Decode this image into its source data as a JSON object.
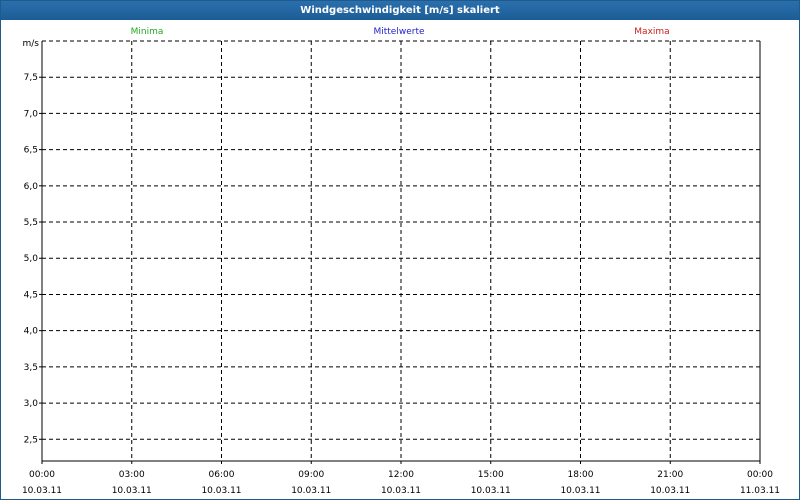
{
  "window": {
    "title": "Windgeschwindigkeit [m/s] skaliert"
  },
  "colors": {
    "minima": "#22aa22",
    "mittelwerte": "#2222cc",
    "maxima": "#cc2222",
    "titlebar": "#1f5a8c"
  },
  "chart_data": {
    "type": "line",
    "title": "Windgeschwindigkeit [m/s] skaliert",
    "ylabel": "m/s",
    "xlabel": "",
    "ylim": [
      2.2,
      8.0
    ],
    "yticks": [
      2.5,
      3.0,
      3.5,
      4.0,
      4.5,
      5.0,
      5.5,
      6.0,
      6.5,
      7.0,
      7.5
    ],
    "ytick_labels": [
      "2,5",
      "3,0",
      "3,5",
      "4,0",
      "4,5",
      "5,0",
      "5,5",
      "6,0",
      "6,5",
      "7,0",
      "7,5"
    ],
    "y_top_gridline": 8.0,
    "xticks": [
      {
        "time": "00:00",
        "date": "10.03.11"
      },
      {
        "time": "03:00",
        "date": "10.03.11"
      },
      {
        "time": "06:00",
        "date": "10.03.11"
      },
      {
        "time": "09:00",
        "date": "10.03.11"
      },
      {
        "time": "12:00",
        "date": "10.03.11"
      },
      {
        "time": "15:00",
        "date": "10.03.11"
      },
      {
        "time": "18:00",
        "date": "10.03.11"
      },
      {
        "time": "21:00",
        "date": "10.03.11"
      },
      {
        "time": "00:00",
        "date": "11.03.11"
      }
    ],
    "grid": true,
    "legend_position": "top",
    "series": [
      {
        "name": "Minima",
        "color": "#22aa22",
        "values": []
      },
      {
        "name": "Mittelwerte",
        "color": "#2222cc",
        "values": []
      },
      {
        "name": "Maxima",
        "color": "#cc2222",
        "values": []
      }
    ]
  }
}
